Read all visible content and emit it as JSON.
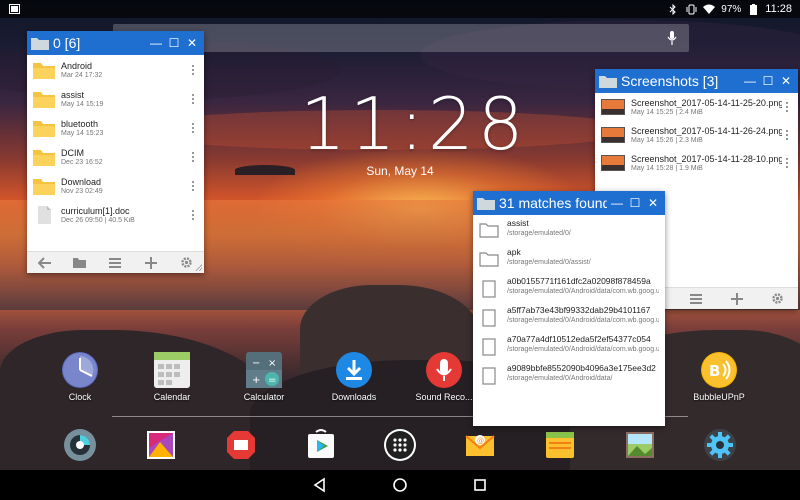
{
  "status_bar": {
    "battery": "97%",
    "time": "11:28"
  },
  "lockclock": {
    "time": "11:28",
    "date": "Sun, May 14"
  },
  "windows": {
    "files": {
      "title": "0 [6]",
      "items": [
        {
          "name": "Android",
          "meta": "Mar 24 17:32",
          "type": "folder"
        },
        {
          "name": "assist",
          "meta": "May 14 15:19",
          "type": "folder"
        },
        {
          "name": "bluetooth",
          "meta": "May 14 15:23",
          "type": "folder"
        },
        {
          "name": "DCIM",
          "meta": "Dec 23 16:52",
          "type": "folder"
        },
        {
          "name": "Download",
          "meta": "Nov 23 02:49",
          "type": "folder"
        },
        {
          "name": "curriculum[1].doc",
          "meta": "Dec 26 09:50 | 40.5 KiB",
          "type": "file"
        }
      ]
    },
    "screenshots": {
      "title": "Screenshots [3]",
      "items": [
        {
          "name": "Screenshot_2017-05-14-11-25-20.png",
          "meta": "May 14 15:25 | 2.4 MiB"
        },
        {
          "name": "Screenshot_2017-05-14-11-26-24.png",
          "meta": "May 14 15:26 | 2.3 MiB"
        },
        {
          "name": "Screenshot_2017-05-14-11-28-10.png",
          "meta": "May 14 15:28 | 1.9 MiB"
        }
      ]
    },
    "matches": {
      "title": "31 matches found",
      "items": [
        {
          "name": "assist",
          "path": "/storage/emulated/0/",
          "type": "folder"
        },
        {
          "name": "apk",
          "path": "/storage/emulated/0/assist/",
          "type": "folder"
        },
        {
          "name": "a0b0155771f161dfc2a02098f878459a",
          "path": "/storage/emulated/0/Android/data/com.wb.goog.uncle.missionberlin/cache/UnityShaderCache/",
          "type": "file"
        },
        {
          "name": "a5ff7ab73e43bf99332dab29b4101167",
          "path": "/storage/emulated/0/Android/data/com.wb.goog.uncle.missionberlin/cache/UnityShaderCache/",
          "type": "file"
        },
        {
          "name": "a70a77a4df10512eda5f2ef54377c054",
          "path": "/storage/emulated/0/Android/data/com.wb.goog.uncle.missionberlin/cache/UnityShaderCache/",
          "type": "file"
        },
        {
          "name": "a9089bbfe8552090b4096a3e175ee3d2",
          "path": "/storage/emulated/0/Android/data/",
          "type": "file"
        }
      ]
    }
  },
  "apps": [
    {
      "label": "Clock"
    },
    {
      "label": "Calendar"
    },
    {
      "label": "Calculator"
    },
    {
      "label": "Downloads"
    },
    {
      "label": "Sound Reco..."
    },
    {
      "label": "BubbleUPnP"
    }
  ],
  "colors": {
    "window_title_bar": "#1f6fd0",
    "folder": "#f5c342",
    "downloads": "#1e88e5",
    "sound_recorder": "#e53935",
    "bubbleupnp": "#f4b400"
  }
}
